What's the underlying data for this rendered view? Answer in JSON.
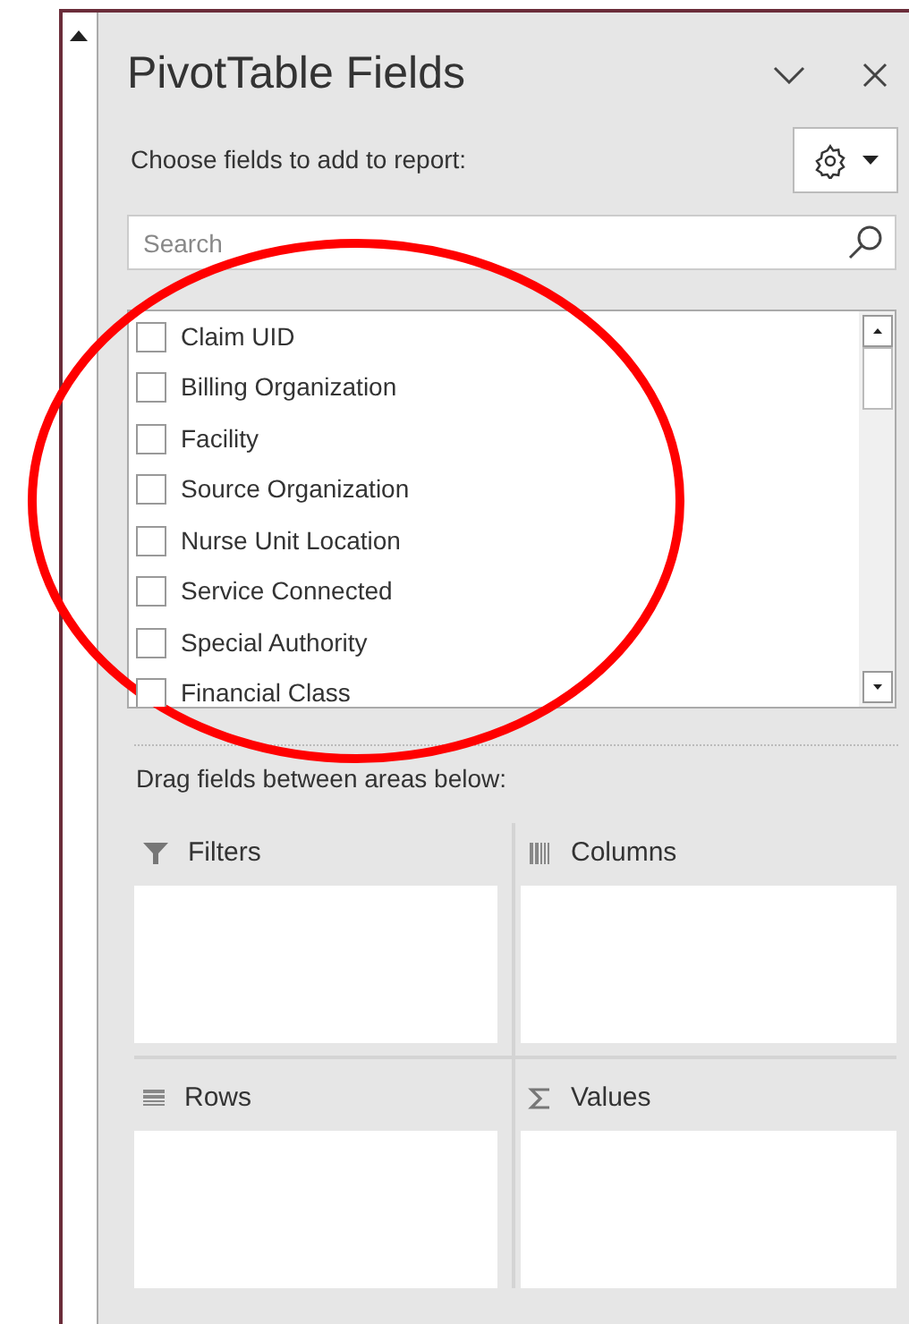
{
  "panel": {
    "title": "PivotTable Fields",
    "instruction": "Choose fields to add to report:"
  },
  "search": {
    "placeholder": "Search"
  },
  "fields": [
    {
      "label": "Claim UID",
      "checked": false
    },
    {
      "label": "Billing Organization",
      "checked": false
    },
    {
      "label": "Facility",
      "checked": false
    },
    {
      "label": "Source Organization",
      "checked": false
    },
    {
      "label": "Nurse Unit Location",
      "checked": false
    },
    {
      "label": "Service Connected",
      "checked": false
    },
    {
      "label": "Special Authority",
      "checked": false
    },
    {
      "label": "Financial Class",
      "checked": false
    }
  ],
  "areas_label": "Drag fields between areas below:",
  "areas": [
    {
      "kind": "filters",
      "label": "Filters"
    },
    {
      "kind": "columns",
      "label": "Columns"
    },
    {
      "kind": "rows",
      "label": "Rows"
    },
    {
      "kind": "values",
      "label": "Values"
    }
  ]
}
